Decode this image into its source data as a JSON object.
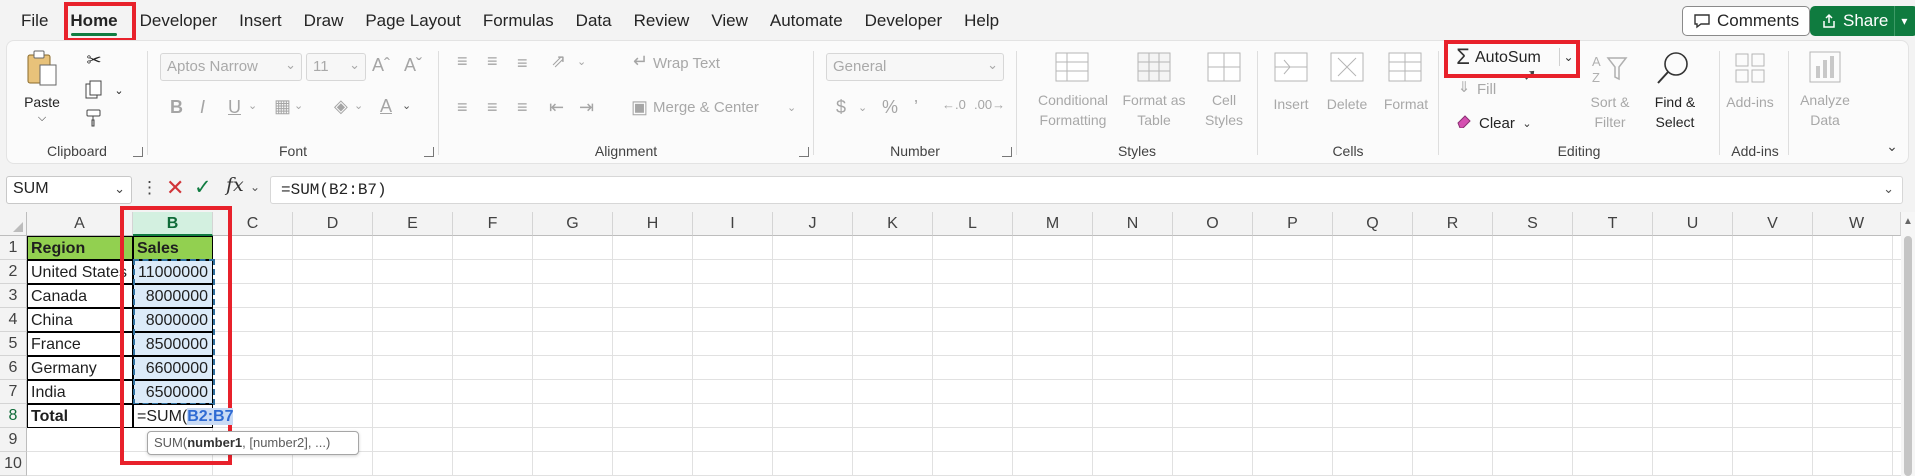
{
  "menu": {
    "tabs": [
      {
        "label": "File"
      },
      {
        "label": "Home",
        "active": true
      },
      {
        "label": "Developer"
      },
      {
        "label": "Insert"
      },
      {
        "label": "Draw"
      },
      {
        "label": "Page Layout"
      },
      {
        "label": "Formulas"
      },
      {
        "label": "Data"
      },
      {
        "label": "Review"
      },
      {
        "label": "View"
      },
      {
        "label": "Automate"
      },
      {
        "label": "Developer"
      },
      {
        "label": "Help"
      }
    ],
    "comments_label": "Comments",
    "share_label": "Share"
  },
  "ribbon": {
    "clipboard": {
      "label": "Clipboard",
      "paste": "Paste"
    },
    "font": {
      "label": "Font",
      "font_name": "Aptos Narrow",
      "font_size": "11"
    },
    "alignment": {
      "label": "Alignment",
      "wrap_text": "Wrap Text",
      "merge_center": "Merge & Center"
    },
    "number": {
      "label": "Number",
      "format": "General"
    },
    "styles": {
      "label": "Styles",
      "conditional_1": "Conditional",
      "conditional_2": "Formatting",
      "format_table_1": "Format as",
      "format_table_2": "Table",
      "cell_styles_1": "Cell",
      "cell_styles_2": "Styles"
    },
    "cells": {
      "label": "Cells",
      "insert": "Insert",
      "delete": "Delete",
      "format": "Format"
    },
    "editing": {
      "label": "Editing",
      "autosum": "AutoSum",
      "fill": "Fill",
      "clear": "Clear",
      "sort_filter_1": "Sort &",
      "sort_filter_2": "Filter",
      "find_select_1": "Find &",
      "find_select_2": "Select"
    },
    "addins": {
      "label": "Add-ins",
      "addins": "Add-ins",
      "analyze_1": "Analyze",
      "analyze_2": "Data"
    }
  },
  "formula_bar": {
    "name_box": "SUM",
    "formula": "=SUM(B2:B7)"
  },
  "grid": {
    "columns": [
      "A",
      "B",
      "C",
      "D",
      "E",
      "F",
      "G",
      "H",
      "I",
      "J",
      "K",
      "L",
      "M",
      "N",
      "O",
      "P",
      "Q",
      "R",
      "S",
      "T",
      "U",
      "V",
      "W"
    ],
    "rows": [
      "1",
      "2",
      "3",
      "4",
      "5",
      "6",
      "7",
      "8",
      "9",
      "10"
    ],
    "header": {
      "region": "Region",
      "sales": "Sales"
    },
    "data": [
      {
        "region": "United States",
        "sales": "11000000"
      },
      {
        "region": "Canada",
        "sales": "8000000"
      },
      {
        "region": "China",
        "sales": "8000000"
      },
      {
        "region": "France",
        "sales": "8500000"
      },
      {
        "region": "Germany",
        "sales": "6600000"
      },
      {
        "region": "India",
        "sales": "6500000"
      }
    ],
    "total_label": "Total",
    "edit_prefix": "=SUM(",
    "edit_ref": "B2:B7",
    "tooltip": {
      "fn": "SUM(",
      "arg1": "number1",
      "rest": ", [number2], ...)"
    }
  }
}
